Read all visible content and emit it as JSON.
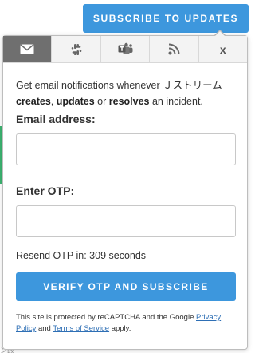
{
  "header": {
    "subscribe_label": "Subscribe to Updates"
  },
  "background": {
    "cut_text": "ン改"
  },
  "tabs": [
    {
      "name": "email",
      "icon": "envelope-icon",
      "active": true
    },
    {
      "name": "slack",
      "icon": "slack-icon",
      "active": false
    },
    {
      "name": "teams",
      "icon": "teams-icon",
      "active": false
    },
    {
      "name": "rss",
      "icon": "rss-icon",
      "active": false
    },
    {
      "name": "close",
      "label": "x",
      "icon": "close-icon",
      "active": false
    }
  ],
  "form": {
    "desc_prefix": "Get email notifications whenever Ｊストリーム",
    "desc_creates": "creates",
    "desc_comma": ", ",
    "desc_updates": "updates",
    "desc_or": " or ",
    "desc_resolves": "resolves",
    "desc_suffix": " an incident.",
    "email_label": "Email address:",
    "email_value": "",
    "otp_label": "Enter OTP:",
    "otp_value": "",
    "resend_text": "Resend OTP in: 309 seconds",
    "verify_label": "Verify OTP and Subscribe"
  },
  "recaptcha": {
    "prefix": "This site is protected by reCAPTCHA and the Google ",
    "privacy_link": "Privacy Policy",
    "and": " and ",
    "terms_link": "Terms of Service",
    "suffix": " apply."
  },
  "colors": {
    "accent": "#3d97dd",
    "active_tab": "#6f6f6f",
    "tab_bg": "#f3f3f3",
    "link": "#2e6fb5",
    "green_bar": "#3cb371"
  }
}
